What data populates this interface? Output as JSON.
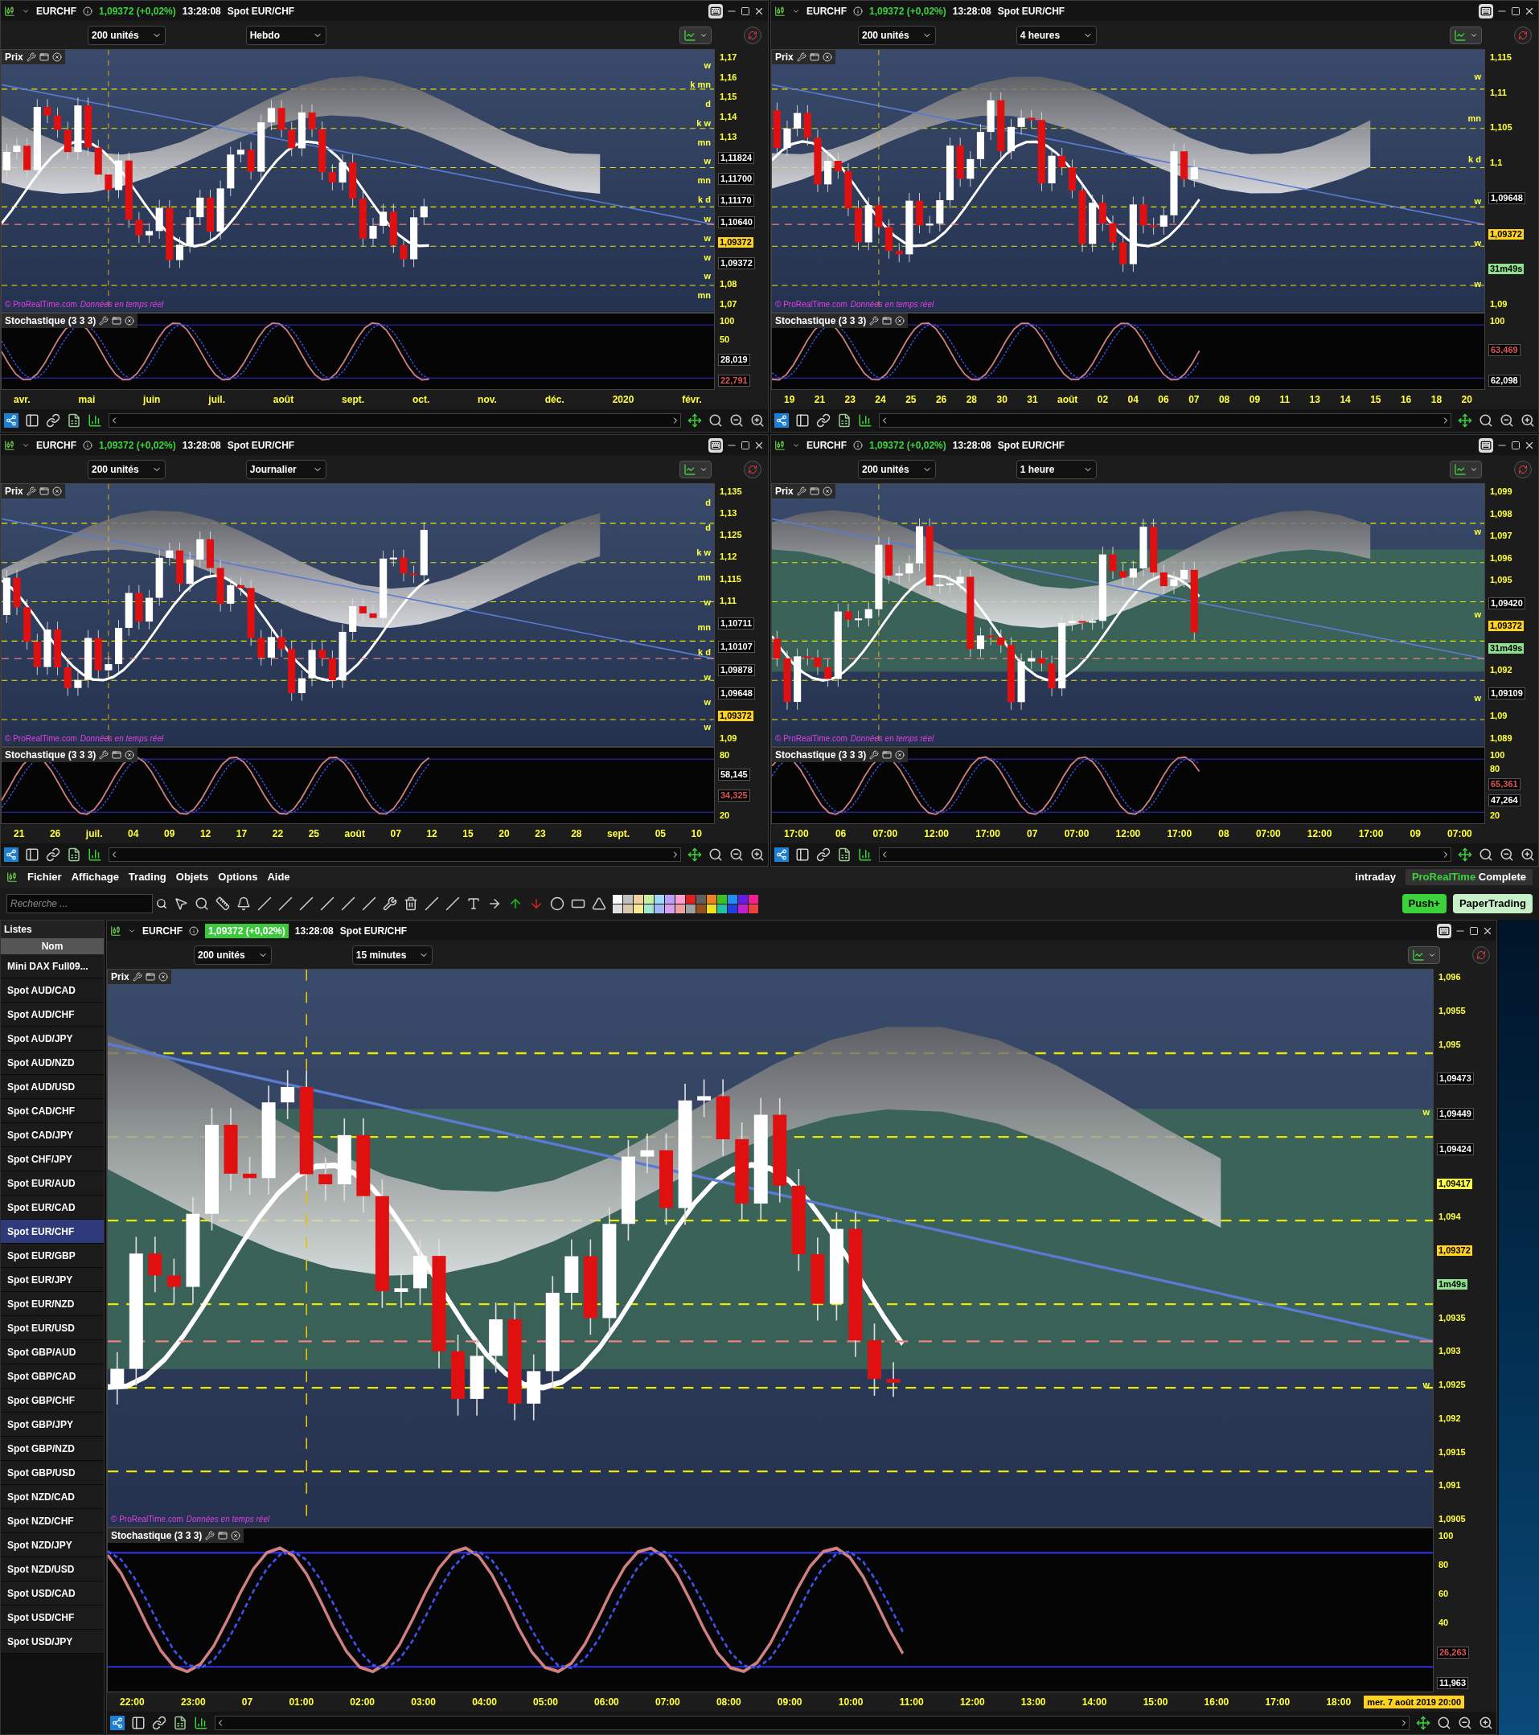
{
  "panels": [
    {
      "symbol": "EURCHF",
      "quote": "1,09372 (+0,02%)",
      "quote_boxed": false,
      "time": "13:28:08",
      "instrument": "Spot EUR/CHF",
      "units": "200 unités",
      "timeframe": "Hebdo",
      "price_pane": "Prix",
      "indicator_pane": "Stochastique (3 3 3)",
      "copyright": "© ProRealTime.com",
      "feed": "Données en temps réel",
      "levels": [
        "w",
        "k mn",
        "d",
        "k w",
        "mn",
        "w",
        "mn",
        "k d",
        "w",
        "w",
        "w",
        "w",
        "mn"
      ],
      "price_axis": [
        {
          "kind": "tick",
          "text": "1,17"
        },
        {
          "kind": "tick",
          "text": "1,16"
        },
        {
          "kind": "tick",
          "text": "1,15"
        },
        {
          "kind": "tick",
          "text": "1,14"
        },
        {
          "kind": "tick",
          "text": "1,13"
        },
        {
          "kind": "value",
          "text": "1,11824"
        },
        {
          "kind": "value",
          "text": "1,11700"
        },
        {
          "kind": "value",
          "text": "1,11170"
        },
        {
          "kind": "value",
          "text": "1,10640"
        },
        {
          "kind": "last",
          "text": "1,09372"
        },
        {
          "kind": "value",
          "text": "1,09372"
        },
        {
          "kind": "tick",
          "text": "1,08"
        },
        {
          "kind": "tick",
          "text": "1,07"
        }
      ],
      "indicator_axis": [
        {
          "kind": "tick",
          "text": "100"
        },
        {
          "kind": "tick",
          "text": "50"
        },
        {
          "kind": "value",
          "text": "28,019"
        },
        {
          "kind": "red",
          "text": "22,791"
        }
      ],
      "x_axis": [
        "avr.",
        "mai",
        "juin",
        "juil.",
        "août",
        "sept.",
        "oct.",
        "nov.",
        "déc.",
        "2020",
        "févr."
      ]
    },
    {
      "symbol": "EURCHF",
      "quote": "1,09372 (+0,02%)",
      "quote_boxed": false,
      "time": "13:28:08",
      "instrument": "Spot EUR/CHF",
      "units": "200 unités",
      "timeframe": "4 heures",
      "price_pane": "Prix",
      "indicator_pane": "Stochastique (3 3 3)",
      "copyright": "© ProRealTime.com",
      "feed": "Données en temps réel",
      "levels": [
        "w",
        "mn",
        "k d",
        "w",
        "w",
        "w"
      ],
      "price_axis": [
        {
          "kind": "tick",
          "text": "1,115"
        },
        {
          "kind": "tick",
          "text": "1,11"
        },
        {
          "kind": "tick",
          "text": "1,105"
        },
        {
          "kind": "tick",
          "text": "1,1"
        },
        {
          "kind": "value",
          "text": "1,09648"
        },
        {
          "kind": "last",
          "text": "1,09372"
        },
        {
          "kind": "timer",
          "text": "31m49s"
        },
        {
          "kind": "tick",
          "text": "1,09"
        }
      ],
      "indicator_axis": [
        {
          "kind": "tick",
          "text": "100"
        },
        {
          "kind": "red",
          "text": "63,469"
        },
        {
          "kind": "value",
          "text": "62,098"
        }
      ],
      "x_axis": [
        "19",
        "21",
        "23",
        "24",
        "25",
        "26",
        "28",
        "30",
        "31",
        "août",
        "02",
        "04",
        "06",
        "07",
        "08",
        "09",
        "11",
        "13",
        "14",
        "15",
        "16",
        "18",
        "20"
      ]
    },
    {
      "symbol": "EURCHF",
      "quote": "1,09372 (+0,02%)",
      "quote_boxed": false,
      "time": "13:28:08",
      "instrument": "Spot EUR/CHF",
      "units": "200 unités",
      "timeframe": "Journalier",
      "price_pane": "Prix",
      "indicator_pane": "Stochastique (3 3 3)",
      "copyright": "© ProRealTime.com",
      "feed": "Données en temps réel",
      "levels": [
        "d",
        "d",
        "k w",
        "mn",
        "w",
        "mn",
        "k d",
        "w",
        "w",
        "w"
      ],
      "price_axis": [
        {
          "kind": "tick",
          "text": "1,135"
        },
        {
          "kind": "tick",
          "text": "1,13"
        },
        {
          "kind": "tick",
          "text": "1,125"
        },
        {
          "kind": "tick",
          "text": "1,12"
        },
        {
          "kind": "tick",
          "text": "1,115"
        },
        {
          "kind": "tick",
          "text": "1,11"
        },
        {
          "kind": "value",
          "text": "1,10711"
        },
        {
          "kind": "value",
          "text": "1,10107"
        },
        {
          "kind": "value",
          "text": "1,09878"
        },
        {
          "kind": "value",
          "text": "1,09648"
        },
        {
          "kind": "last",
          "text": "1,09372"
        },
        {
          "kind": "tick",
          "text": "1,09"
        }
      ],
      "indicator_axis": [
        {
          "kind": "tick",
          "text": "80"
        },
        {
          "kind": "value",
          "text": "58,145"
        },
        {
          "kind": "red",
          "text": "34,325"
        },
        {
          "kind": "tick",
          "text": "20"
        }
      ],
      "x_axis": [
        "21",
        "26",
        "juil.",
        "04",
        "09",
        "12",
        "17",
        "22",
        "25",
        "août",
        "07",
        "12",
        "15",
        "20",
        "23",
        "28",
        "sept.",
        "05",
        "10"
      ]
    },
    {
      "symbol": "EURCHF",
      "quote": "1,09372 (+0,02%)",
      "quote_boxed": false,
      "time": "13:28:08",
      "instrument": "Spot EUR/CHF",
      "units": "200 unités",
      "timeframe": "1 heure",
      "price_pane": "Prix",
      "indicator_pane": "Stochastique (3 3 3)",
      "copyright": "© ProRealTime.com",
      "feed": "Données en temps réel",
      "levels": [
        "w",
        "w",
        "w"
      ],
      "price_axis": [
        {
          "kind": "tick",
          "text": "1,099"
        },
        {
          "kind": "tick",
          "text": "1,098"
        },
        {
          "kind": "tick",
          "text": "1,097"
        },
        {
          "kind": "tick",
          "text": "1,096"
        },
        {
          "kind": "tick",
          "text": "1,095"
        },
        {
          "kind": "value",
          "text": "1,09420"
        },
        {
          "kind": "last",
          "text": "1,09372"
        },
        {
          "kind": "timer",
          "text": "31m49s"
        },
        {
          "kind": "tick",
          "text": "1,092"
        },
        {
          "kind": "value",
          "text": "1,09109"
        },
        {
          "kind": "tick",
          "text": "1,09"
        },
        {
          "kind": "tick",
          "text": "1,089"
        }
      ],
      "indicator_axis": [
        {
          "kind": "tick",
          "text": "100"
        },
        {
          "kind": "tick",
          "text": "80"
        },
        {
          "kind": "red",
          "text": "65,361"
        },
        {
          "kind": "value",
          "text": "47,264"
        },
        {
          "kind": "tick",
          "text": "20"
        }
      ],
      "x_axis": [
        "17:00",
        "06",
        "07:00",
        "12:00",
        "17:00",
        "07",
        "07:00",
        "12:00",
        "17:00",
        "08",
        "07:00",
        "12:00",
        "17:00",
        "09",
        "07:00"
      ]
    }
  ],
  "menu": [
    "Fichier",
    "Affichage",
    "Trading",
    "Objets",
    "Options",
    "Aide"
  ],
  "menu_right": {
    "mode": "intraday",
    "brand": "ProRealTime",
    "edition": "Complete"
  },
  "toolbar": {
    "search_placeholder": "Recherche ...",
    "push_button": "Push+",
    "paper_button": "PaperTrading"
  },
  "palette": [
    {
      "color": "#ffffff"
    },
    {
      "color": "#e0e0e0"
    },
    {
      "color": "#c0c0c0"
    },
    {
      "color": "#d8c8b0"
    },
    {
      "color": "#f0d0a0"
    },
    {
      "color": "#f8e890"
    },
    {
      "color": "#c8f0a0"
    },
    {
      "color": "#a0e8d0"
    },
    {
      "color": "#a0d8f8"
    },
    {
      "color": "#a0b8f8"
    },
    {
      "color": "#b8a0f8"
    },
    {
      "color": "#d8a0f0"
    },
    {
      "color": "#f8a0d0"
    },
    {
      "color": "#f0a0a0"
    },
    {
      "color": "#e02020"
    },
    {
      "color": "#a0a0a0"
    },
    {
      "color": "#606060"
    },
    {
      "color": "#905020"
    },
    {
      "color": "#f08020"
    },
    {
      "color": "#f0e020"
    },
    {
      "color": "#40c020"
    },
    {
      "color": "#20c0a0"
    },
    {
      "color": "#2090f0"
    },
    {
      "color": "#2040e0"
    },
    {
      "color": "#6020e0"
    },
    {
      "color": "#c020d0"
    },
    {
      "color": "#f02090"
    },
    {
      "color": "#f04040"
    }
  ],
  "lists": {
    "title": "Listes",
    "column": "Nom",
    "items": [
      {
        "label": "Mini DAX Full09...",
        "selected": false
      },
      {
        "label": "Spot AUD/CAD",
        "selected": false
      },
      {
        "label": "Spot AUD/CHF",
        "selected": false
      },
      {
        "label": "Spot AUD/JPY",
        "selected": false
      },
      {
        "label": "Spot AUD/NZD",
        "selected": false
      },
      {
        "label": "Spot AUD/USD",
        "selected": false
      },
      {
        "label": "Spot CAD/CHF",
        "selected": false
      },
      {
        "label": "Spot CAD/JPY",
        "selected": false
      },
      {
        "label": "Spot CHF/JPY",
        "selected": false
      },
      {
        "label": "Spot EUR/AUD",
        "selected": false
      },
      {
        "label": "Spot EUR/CAD",
        "selected": false
      },
      {
        "label": "Spot EUR/CHF",
        "selected": true
      },
      {
        "label": "Spot EUR/GBP",
        "selected": false
      },
      {
        "label": "Spot EUR/JPY",
        "selected": false
      },
      {
        "label": "Spot EUR/NZD",
        "selected": false
      },
      {
        "label": "Spot EUR/USD",
        "selected": false
      },
      {
        "label": "Spot GBP/AUD",
        "selected": false
      },
      {
        "label": "Spot GBP/CAD",
        "selected": false
      },
      {
        "label": "Spot GBP/CHF",
        "selected": false
      },
      {
        "label": "Spot GBP/JPY",
        "selected": false
      },
      {
        "label": "Spot GBP/NZD",
        "selected": false
      },
      {
        "label": "Spot GBP/USD",
        "selected": false
      },
      {
        "label": "Spot NZD/CAD",
        "selected": false
      },
      {
        "label": "Spot NZD/CHF",
        "selected": false
      },
      {
        "label": "Spot NZD/JPY",
        "selected": false
      },
      {
        "label": "Spot NZD/USD",
        "selected": false
      },
      {
        "label": "Spot USD/CAD",
        "selected": false
      },
      {
        "label": "Spot USD/CHF",
        "selected": false
      },
      {
        "label": "Spot USD/JPY",
        "selected": false
      }
    ]
  },
  "main_chart": {
    "symbol": "EURCHF",
    "quote": "1,09372 (+0,02%)",
    "quote_boxed": true,
    "time": "13:28:08",
    "instrument": "Spot EUR/CHF",
    "units": "200 unités",
    "timeframe": "15 minutes",
    "price_pane": "Prix",
    "indicator_pane": "Stochastique (3 3 3)",
    "copyright": "© ProRealTime.com",
    "feed": "Données en temps réel",
    "levels": [
      "w",
      "w"
    ],
    "price_axis": [
      {
        "kind": "tick",
        "text": "1,096"
      },
      {
        "kind": "tick",
        "text": "1,0955"
      },
      {
        "kind": "tick",
        "text": "1,095"
      },
      {
        "kind": "value",
        "text": "1,09473"
      },
      {
        "kind": "value",
        "text": "1,09449"
      },
      {
        "kind": "value",
        "text": "1,09424"
      },
      {
        "kind": "highlight",
        "text": "1,09417"
      },
      {
        "kind": "tick",
        "text": "1,094"
      },
      {
        "kind": "last",
        "text": "1,09372"
      },
      {
        "kind": "timer",
        "text": "1m49s"
      },
      {
        "kind": "tick",
        "text": "1,0935"
      },
      {
        "kind": "tick",
        "text": "1,093"
      },
      {
        "kind": "tick",
        "text": "1,0925"
      },
      {
        "kind": "tick",
        "text": "1,092"
      },
      {
        "kind": "tick",
        "text": "1,0915"
      },
      {
        "kind": "tick",
        "text": "1,091"
      },
      {
        "kind": "tick",
        "text": "1,0905"
      }
    ],
    "indicator_axis": [
      {
        "kind": "tick",
        "text": "100"
      },
      {
        "kind": "tick",
        "text": "80"
      },
      {
        "kind": "tick",
        "text": "60"
      },
      {
        "kind": "tick",
        "text": "40"
      },
      {
        "kind": "red",
        "text": "26,263"
      },
      {
        "kind": "value",
        "text": "11,963"
      }
    ],
    "x_axis": [
      "22:00",
      "23:00",
      "07",
      "01:00",
      "02:00",
      "03:00",
      "04:00",
      "05:00",
      "06:00",
      "07:00",
      "08:00",
      "09:00",
      "10:00",
      "11:00",
      "12:00",
      "13:00",
      "14:00",
      "15:00",
      "16:00",
      "17:00",
      "18:00"
    ],
    "date_tag": "mer. 7 août 2019 20:00"
  }
}
